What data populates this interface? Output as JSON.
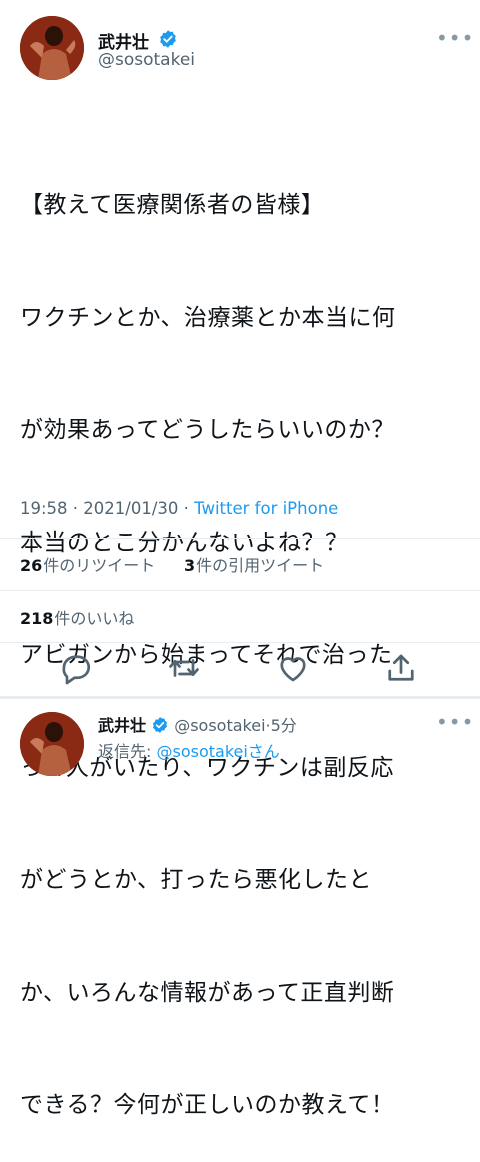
{
  "tweet": {
    "author_name": "武井壮",
    "author_handle": "@sosotakei",
    "more_icon": "more-icon",
    "lines": [
      "【教えて医療関係者の皆様】",
      "ワクチンとか、治療薬とか本当に何",
      "が効果あってどうしたらいいのか？",
      "本当のとこ分かんないよね？？",
      "アビガンから始まってそれで治った",
      "って人がいたり、ワクチンは副反応",
      "がどうとか、打ったら悪化したと",
      "か、いろんな情報があって正直判断",
      "できる？今何が正しいのか教えて！"
    ],
    "time": "19:58 · 2021/01/30 · ",
    "source": "Twitter for iPhone"
  },
  "stats": {
    "retweets_count": "26",
    "retweets_label": "件のリツイート",
    "quotes_count": "3",
    "quotes_label": "件の引用ツイート",
    "likes_count": "218",
    "likes_label": "件のいいね"
  },
  "actions": [
    "reply-icon",
    "retweet-icon",
    "like-icon",
    "share-icon"
  ],
  "reply": {
    "author_name": "武井壮",
    "author_handle": "@sosotakei",
    "age": "·5分",
    "reply_to_prefix": "返信先: ",
    "reply_to_mention": "@sosotakeiさん"
  },
  "colors": {
    "accent": "#1d9bf0",
    "secondary_text": "#536471"
  }
}
